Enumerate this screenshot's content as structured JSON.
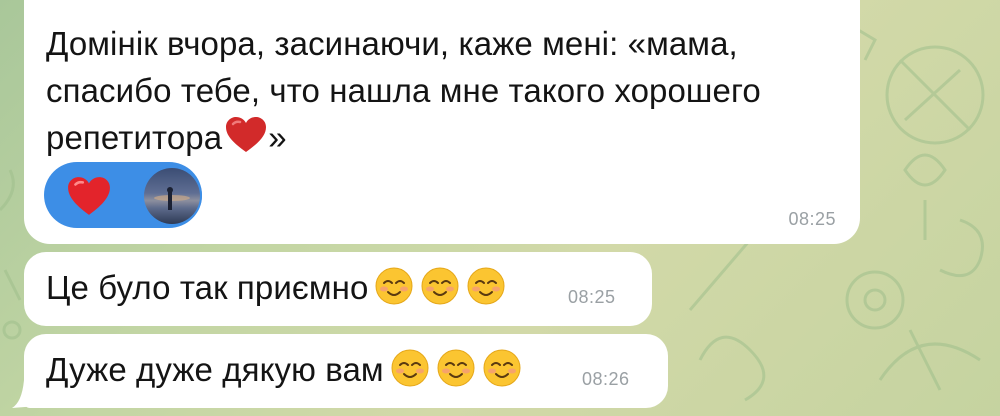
{
  "chat": {
    "messages": [
      {
        "text": "Домінік вчора, засинаючи, каже мені: «мама,\nспасибо тебе, что нашла мне такого хорошего\nрепетитора",
        "text_tail": "»",
        "time": "08:25",
        "reaction": {
          "emoji": "red-heart",
          "color": "#3d8ee6"
        }
      },
      {
        "text": "Це було так приємно",
        "time": "08:25",
        "emojis": [
          "smiling-face",
          "smiling-face",
          "smiling-face"
        ]
      },
      {
        "text": "Дуже дуже дякую вам",
        "time": "08:26",
        "emojis": [
          "smiling-face",
          "smiling-face",
          "smiling-face"
        ]
      }
    ]
  },
  "colors": {
    "bubble": "#ffffff",
    "reaction_pill": "#3d8ee6",
    "timestamp": "#9aa0a4",
    "wallpaper": "#c3d6a4"
  }
}
